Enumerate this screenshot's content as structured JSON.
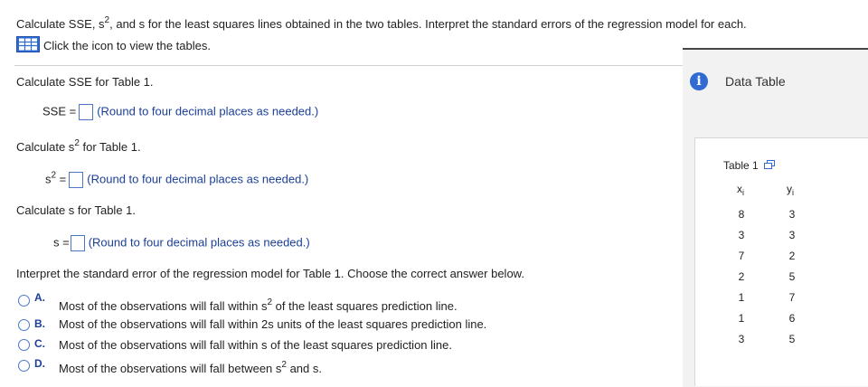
{
  "header": {
    "prompt_start": "Calculate SSE, s",
    "prompt_sup": "2",
    "prompt_end": ", and s for the least squares lines obtained in the two tables. Interpret the standard errors of the regression model for each.",
    "view_tables_text": "Click the icon to view the tables."
  },
  "sse": {
    "prompt": "Calculate SSE for Table 1.",
    "label": "SSE =",
    "hint": "(Round to four decimal places as needed.)"
  },
  "s2": {
    "prompt_start": "Calculate s",
    "prompt_sup": "2",
    "prompt_end": " for Table 1.",
    "label_base": "s",
    "label_sup": "2",
    "label_eq": " =",
    "hint": "(Round to four decimal places as needed.)"
  },
  "s": {
    "prompt": "Calculate s for Table 1.",
    "label": "s =",
    "hint": "(Round to four decimal places as needed.)"
  },
  "interpret": {
    "prompt": "Interpret the standard error of the regression model for Table 1. Choose the correct answer below.",
    "options": [
      {
        "letter": "A.",
        "text_start": "Most of the observations will fall within s",
        "sup": "2",
        "text_end": " of the least squares prediction line."
      },
      {
        "letter": "B.",
        "text": "Most of the observations will fall within 2s units of the least squares prediction line."
      },
      {
        "letter": "C.",
        "text": "Most of the observations will fall within s of the least squares prediction line."
      },
      {
        "letter": "D.",
        "text_start": "Most of the observations will fall between s",
        "sup": "2",
        "text_end": " and s."
      }
    ]
  },
  "data_panel": {
    "title": "Data Table",
    "info_icon_glyph": "i",
    "table_title": "Table 1",
    "col_x": "x",
    "col_y": "y",
    "col_sub": "i",
    "rows": [
      [
        "8",
        "3"
      ],
      [
        "3",
        "3"
      ],
      [
        "7",
        "2"
      ],
      [
        "2",
        "5"
      ],
      [
        "1",
        "7"
      ],
      [
        "1",
        "6"
      ],
      [
        "3",
        "5"
      ]
    ]
  },
  "colors": {
    "accent_blue": "#1b3f97",
    "input_border": "#4a78c7",
    "info_icon": "#2f6bd2"
  }
}
